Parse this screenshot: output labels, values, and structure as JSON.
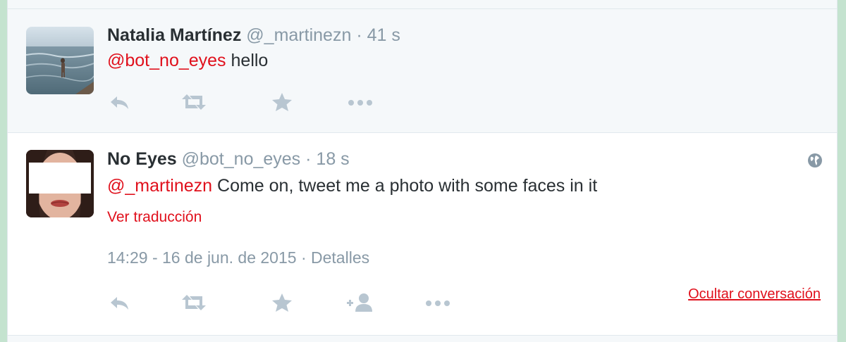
{
  "tweets": [
    {
      "name": "Natalia Martínez",
      "handle": "@_martinezn",
      "time": "· 41 s",
      "mention": "@bot_no_eyes",
      "text": " hello",
      "actions": [
        "reply-icon",
        "retweet-icon",
        "favorite-icon",
        "more-icon"
      ]
    },
    {
      "name": "No Eyes",
      "handle": "@bot_no_eyes",
      "time": "· 18 s",
      "mention": "@_martinezn",
      "text": " Come on, tweet me a photo with some faces in it",
      "translate": "Ver traducción",
      "datetime": "14:29 - 16 de jun. de 2015",
      "details": "Detalles",
      "hide_conversation": "Ocultar conversación",
      "actions": [
        "reply-icon",
        "retweet-icon",
        "favorite-icon",
        "follow-icon",
        "more-icon"
      ]
    }
  ],
  "colors": {
    "background": "#c4e3cf",
    "link": "#e0101c",
    "muted": "#8899a6",
    "icon": "#b8c6d1",
    "text": "#292f33"
  }
}
